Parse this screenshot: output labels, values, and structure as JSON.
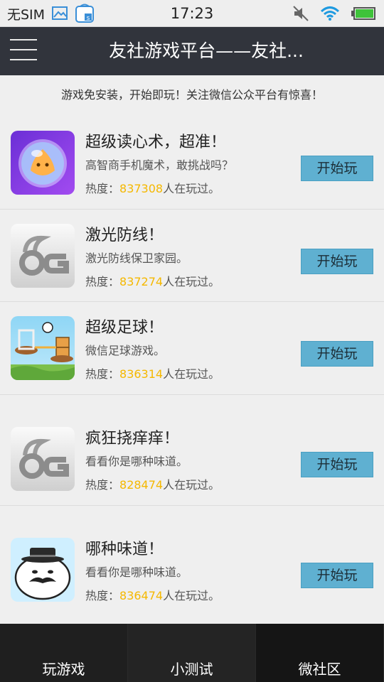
{
  "status_bar": {
    "carrier": "无SIM",
    "time": "17:23"
  },
  "header": {
    "title": "友社游戏平台——友社..."
  },
  "notice": "游戏免安装，开始即玩！关注微信公众平台有惊喜！",
  "heat_prefix": "热度：",
  "heat_suffix": "人在玩过。",
  "play_label": "开始玩",
  "games": [
    {
      "title": "超级读心术，超准！",
      "desc": "高智商手机魔术，敢挑战吗？",
      "heat": "837308",
      "icon": "crystal-ball-icon"
    },
    {
      "title": "激光防线！",
      "desc": "激光防线保卫家园。",
      "heat": "837274",
      "icon": "9g-logo-icon"
    },
    {
      "title": "超级足球！",
      "desc": "微信足球游戏。",
      "heat": "836314",
      "icon": "soccer-game-icon"
    },
    {
      "title": "疯狂挠痒痒！",
      "desc": "看看你是哪种味道。",
      "heat": "828474",
      "icon": "9g-logo-icon"
    },
    {
      "title": "哪种味道！",
      "desc": "看看你是哪种味道。",
      "heat": "836474",
      "icon": "mustache-face-icon"
    }
  ],
  "bottom_nav": [
    "玩游戏",
    "小测试",
    "微社区"
  ]
}
